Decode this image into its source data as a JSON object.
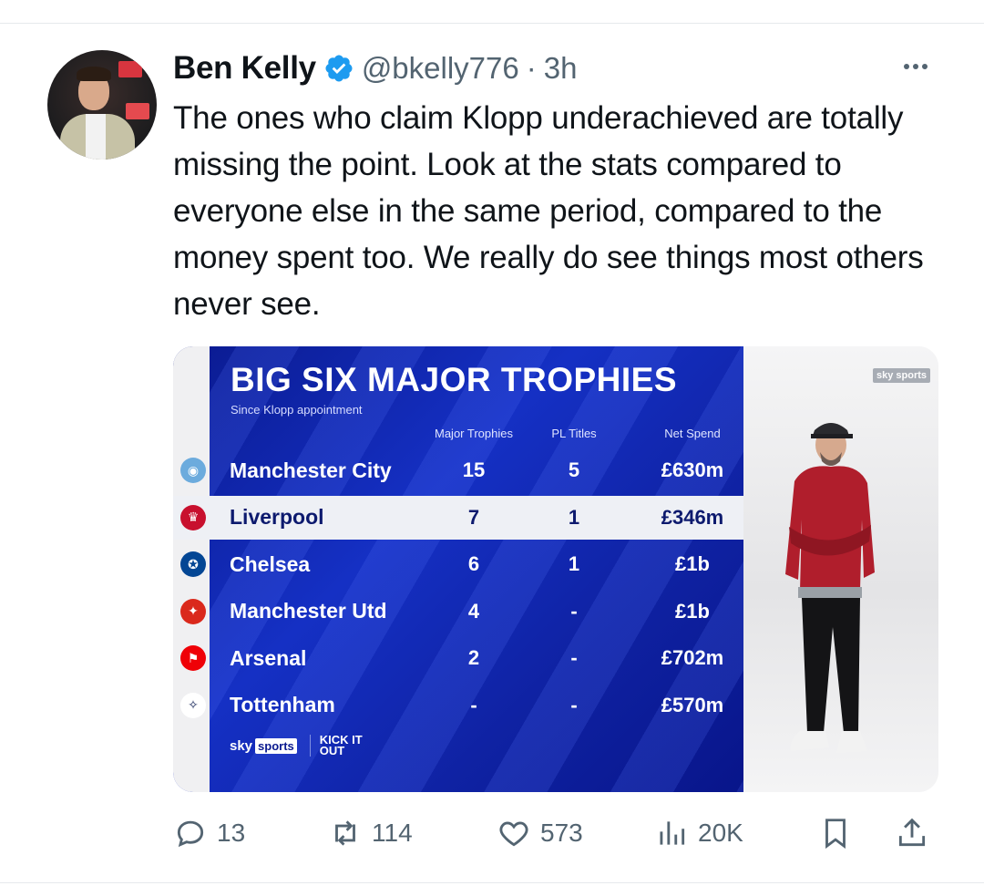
{
  "tweet": {
    "author_name": "Ben Kelly",
    "handle": "@bkelly776",
    "separator": "·",
    "timestamp": "3h",
    "text": "The ones who claim Klopp underachieved are totally missing the point. Look at the stats compared to everyone else in the same period, compared to the money spent too. We really do see things most others never see."
  },
  "graphic": {
    "title": "BIG SIX MAJOR TROPHIES",
    "subtitle": "Since Klopp appointment",
    "columns": [
      "Major Trophies",
      "PL Titles",
      "Net Spend"
    ],
    "rows": [
      {
        "team": "Manchester City",
        "major": "15",
        "pl": "5",
        "spend": "£630m",
        "crest_icon": "man-city-crest-icon",
        "highlight": false
      },
      {
        "team": "Liverpool",
        "major": "7",
        "pl": "1",
        "spend": "£346m",
        "crest_icon": "liverpool-crest-icon",
        "highlight": true
      },
      {
        "team": "Chelsea",
        "major": "6",
        "pl": "1",
        "spend": "£1b",
        "crest_icon": "chelsea-crest-icon",
        "highlight": false
      },
      {
        "team": "Manchester Utd",
        "major": "4",
        "pl": "-",
        "spend": "£1b",
        "crest_icon": "man-utd-crest-icon",
        "highlight": false
      },
      {
        "team": "Arsenal",
        "major": "2",
        "pl": "-",
        "spend": "£702m",
        "crest_icon": "arsenal-crest-icon",
        "highlight": false
      },
      {
        "team": "Tottenham",
        "major": "-",
        "pl": "-",
        "spend": "£570m",
        "crest_icon": "tottenham-crest-icon",
        "highlight": false
      }
    ],
    "sky_word": "sky",
    "sports_word": "sports",
    "kick_logo": "KICK IT OUT",
    "corner_badge": "sky sports"
  },
  "actions": {
    "replies": "13",
    "reposts": "114",
    "likes": "573",
    "views": "20K"
  },
  "colors": {
    "verified": "#1d9bf0",
    "muted": "#536471",
    "graphic_blue": "#1530c4"
  }
}
